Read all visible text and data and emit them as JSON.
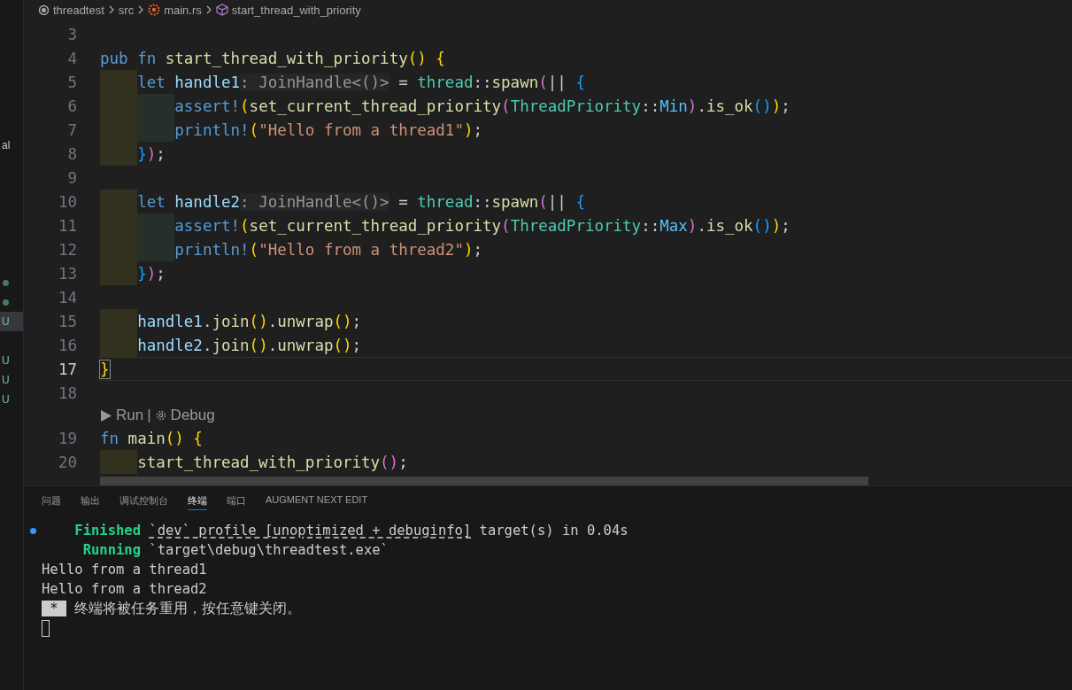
{
  "sidebar": {
    "items": [
      {
        "kind": "text",
        "text": "al",
        "selected": false
      },
      {
        "kind": "dot",
        "selected": false
      },
      {
        "kind": "dot",
        "selected": false
      },
      {
        "kind": "badge",
        "text": "U",
        "selected": true
      },
      {
        "kind": "gap",
        "selected": false
      },
      {
        "kind": "badge",
        "text": "U",
        "selected": false
      },
      {
        "kind": "badge",
        "text": "U",
        "selected": false
      },
      {
        "kind": "badge",
        "text": "U",
        "selected": false
      }
    ]
  },
  "breadcrumb": [
    {
      "kind": "folder",
      "text": "threadtest"
    },
    {
      "kind": "folder",
      "text": "src"
    },
    {
      "kind": "rust-file",
      "text": "main.rs"
    },
    {
      "kind": "symbol",
      "text": "start_thread_with_priority"
    }
  ],
  "editor": {
    "lines": [
      {
        "kind": "code",
        "number": "3",
        "current": false
      },
      {
        "kind": "code",
        "number": "4",
        "current": false,
        "tokens": [
          {
            "kind": "kw",
            "text": "pub fn "
          },
          {
            "kind": "fn",
            "text": "start_thread_with_priority"
          },
          {
            "kind": "b1",
            "text": "() {"
          }
        ]
      },
      {
        "kind": "code",
        "number": "5",
        "current": false,
        "tokens": [
          {
            "kind": "indent1"
          },
          {
            "kind": "kw",
            "text": "let "
          },
          {
            "kind": "var",
            "text": "handle1"
          },
          {
            "kind": "hint",
            "text": ": JoinHandle<()>"
          },
          {
            "kind": "punct",
            "text": " = "
          },
          {
            "kind": "type",
            "text": "thread"
          },
          {
            "kind": "punct",
            "text": "::"
          },
          {
            "kind": "fn",
            "text": "spawn"
          },
          {
            "kind": "b2",
            "text": "("
          },
          {
            "kind": "punct",
            "text": "|| "
          },
          {
            "kind": "b3",
            "text": "{"
          }
        ]
      },
      {
        "kind": "code",
        "number": "6",
        "current": false,
        "tokens": [
          {
            "kind": "indent1"
          },
          {
            "kind": "indent2"
          },
          {
            "kind": "kw",
            "text": "assert!"
          },
          {
            "kind": "b1",
            "text": "("
          },
          {
            "kind": "fn",
            "text": "set_current_thread_priority"
          },
          {
            "kind": "b2",
            "text": "("
          },
          {
            "kind": "type",
            "text": "ThreadPriority"
          },
          {
            "kind": "punct",
            "text": "::"
          },
          {
            "kind": "enum",
            "text": "Min"
          },
          {
            "kind": "b2",
            "text": ")"
          },
          {
            "kind": "punct",
            "text": "."
          },
          {
            "kind": "fn",
            "text": "is_ok"
          },
          {
            "kind": "b3",
            "text": "()"
          },
          {
            "kind": "b1",
            "text": ")"
          },
          {
            "kind": "punct",
            "text": ";"
          }
        ]
      },
      {
        "kind": "code",
        "number": "7",
        "current": false,
        "tokens": [
          {
            "kind": "indent1"
          },
          {
            "kind": "indent2"
          },
          {
            "kind": "kw",
            "text": "println!"
          },
          {
            "kind": "b1",
            "text": "("
          },
          {
            "kind": "string",
            "text": "\"Hello from a thread1\""
          },
          {
            "kind": "b1",
            "text": ")"
          },
          {
            "kind": "punct",
            "text": ";"
          }
        ]
      },
      {
        "kind": "code",
        "number": "8",
        "current": false,
        "tokens": [
          {
            "kind": "indent1"
          },
          {
            "kind": "b3",
            "text": "}"
          },
          {
            "kind": "b2",
            "text": ")"
          },
          {
            "kind": "punct",
            "text": ";"
          }
        ]
      },
      {
        "kind": "code",
        "number": "9",
        "current": false
      },
      {
        "kind": "code",
        "number": "10",
        "current": false,
        "tokens": [
          {
            "kind": "indent1"
          },
          {
            "kind": "kw",
            "text": "let "
          },
          {
            "kind": "var",
            "text": "handle2"
          },
          {
            "kind": "hint",
            "text": ": JoinHandle<()>"
          },
          {
            "kind": "punct",
            "text": " = "
          },
          {
            "kind": "type",
            "text": "thread"
          },
          {
            "kind": "punct",
            "text": "::"
          },
          {
            "kind": "fn",
            "text": "spawn"
          },
          {
            "kind": "b2",
            "text": "("
          },
          {
            "kind": "punct",
            "text": "|| "
          },
          {
            "kind": "b3",
            "text": "{"
          }
        ]
      },
      {
        "kind": "code",
        "number": "11",
        "current": false,
        "tokens": [
          {
            "kind": "indent1"
          },
          {
            "kind": "indent2"
          },
          {
            "kind": "kw",
            "text": "assert!"
          },
          {
            "kind": "b1",
            "text": "("
          },
          {
            "kind": "fn",
            "text": "set_current_thread_priority"
          },
          {
            "kind": "b2",
            "text": "("
          },
          {
            "kind": "type",
            "text": "ThreadPriority"
          },
          {
            "kind": "punct",
            "text": "::"
          },
          {
            "kind": "enum",
            "text": "Max"
          },
          {
            "kind": "b2",
            "text": ")"
          },
          {
            "kind": "punct",
            "text": "."
          },
          {
            "kind": "fn",
            "text": "is_ok"
          },
          {
            "kind": "b3",
            "text": "()"
          },
          {
            "kind": "b1",
            "text": ")"
          },
          {
            "kind": "punct",
            "text": ";"
          }
        ]
      },
      {
        "kind": "code",
        "number": "12",
        "current": false,
        "tokens": [
          {
            "kind": "indent1"
          },
          {
            "kind": "indent2"
          },
          {
            "kind": "kw",
            "text": "println!"
          },
          {
            "kind": "b1",
            "text": "("
          },
          {
            "kind": "string",
            "text": "\"Hello from a thread2\""
          },
          {
            "kind": "b1",
            "text": ")"
          },
          {
            "kind": "punct",
            "text": ";"
          }
        ]
      },
      {
        "kind": "code",
        "number": "13",
        "current": false,
        "tokens": [
          {
            "kind": "indent1"
          },
          {
            "kind": "b3",
            "text": "}"
          },
          {
            "kind": "b2",
            "text": ")"
          },
          {
            "kind": "punct",
            "text": ";"
          }
        ]
      },
      {
        "kind": "code",
        "number": "14",
        "current": false
      },
      {
        "kind": "code",
        "number": "15",
        "current": false,
        "tokens": [
          {
            "kind": "indent1"
          },
          {
            "kind": "var",
            "text": "handle1"
          },
          {
            "kind": "punct",
            "text": "."
          },
          {
            "kind": "fn",
            "text": "join"
          },
          {
            "kind": "b1",
            "text": "()"
          },
          {
            "kind": "punct",
            "text": "."
          },
          {
            "kind": "fn",
            "text": "unwrap"
          },
          {
            "kind": "b1",
            "text": "()"
          },
          {
            "kind": "punct",
            "text": ";"
          }
        ]
      },
      {
        "kind": "code",
        "number": "16",
        "current": false,
        "tokens": [
          {
            "kind": "indent1"
          },
          {
            "kind": "var",
            "text": "handle2"
          },
          {
            "kind": "punct",
            "text": "."
          },
          {
            "kind": "fn",
            "text": "join"
          },
          {
            "kind": "b1",
            "text": "()"
          },
          {
            "kind": "punct",
            "text": "."
          },
          {
            "kind": "fn",
            "text": "unwrap"
          },
          {
            "kind": "b1",
            "text": "()"
          },
          {
            "kind": "punct",
            "text": ";"
          }
        ]
      },
      {
        "kind": "code",
        "number": "17",
        "current": true,
        "tokens": [
          {
            "kind": "match",
            "text": "}"
          }
        ]
      },
      {
        "kind": "code",
        "number": "18",
        "current": false
      },
      {
        "kind": "lens",
        "run": "Run",
        "separator": "|",
        "debug": "Debug"
      },
      {
        "kind": "code",
        "number": "19",
        "current": false,
        "tokens": [
          {
            "kind": "kw",
            "text": "fn "
          },
          {
            "kind": "fn",
            "text": "main"
          },
          {
            "kind": "b1",
            "text": "() {"
          }
        ]
      },
      {
        "kind": "code",
        "number": "20",
        "current": false,
        "tokens": [
          {
            "kind": "indent1"
          },
          {
            "kind": "fn",
            "text": "start_thread_with_priority"
          },
          {
            "kind": "b2",
            "text": "()"
          },
          {
            "kind": "punct",
            "text": ";"
          }
        ]
      }
    ]
  },
  "panel": {
    "tabs": [
      {
        "label": "问题",
        "selected": false
      },
      {
        "label": "输出",
        "selected": false
      },
      {
        "label": "调试控制台",
        "selected": false
      },
      {
        "label": "终端",
        "selected": true
      },
      {
        "label": "端口",
        "selected": false
      },
      {
        "label": "AUGMENT NEXT EDIT",
        "selected": false
      }
    ],
    "terminal": [
      {
        "kind": "text",
        "marker": true,
        "tokens": [
          {
            "kind": "label",
            "text": "    Finished "
          },
          {
            "kind": "link",
            "text": "`dev` profile [unoptimized + debuginfo]"
          },
          {
            "kind": "text",
            "text": " target(s) in 0.04s"
          }
        ]
      },
      {
        "kind": "text",
        "marker": false,
        "tokens": [
          {
            "kind": "label",
            "text": "     Running "
          },
          {
            "kind": "text",
            "text": "`target\\debug\\threadtest.exe`"
          }
        ]
      },
      {
        "kind": "text",
        "marker": false,
        "tokens": [
          {
            "kind": "text",
            "text": "Hello from a thread1"
          }
        ]
      },
      {
        "kind": "text",
        "marker": false,
        "tokens": [
          {
            "kind": "text",
            "text": "Hello from a thread2"
          }
        ]
      },
      {
        "kind": "text",
        "marker": false,
        "tokens": [
          {
            "kind": "badge",
            "text": " * "
          },
          {
            "kind": "text",
            "text": " 终端将被任务重用，按任意键关闭。"
          }
        ]
      },
      {
        "kind": "cursor",
        "marker": false
      }
    ]
  }
}
